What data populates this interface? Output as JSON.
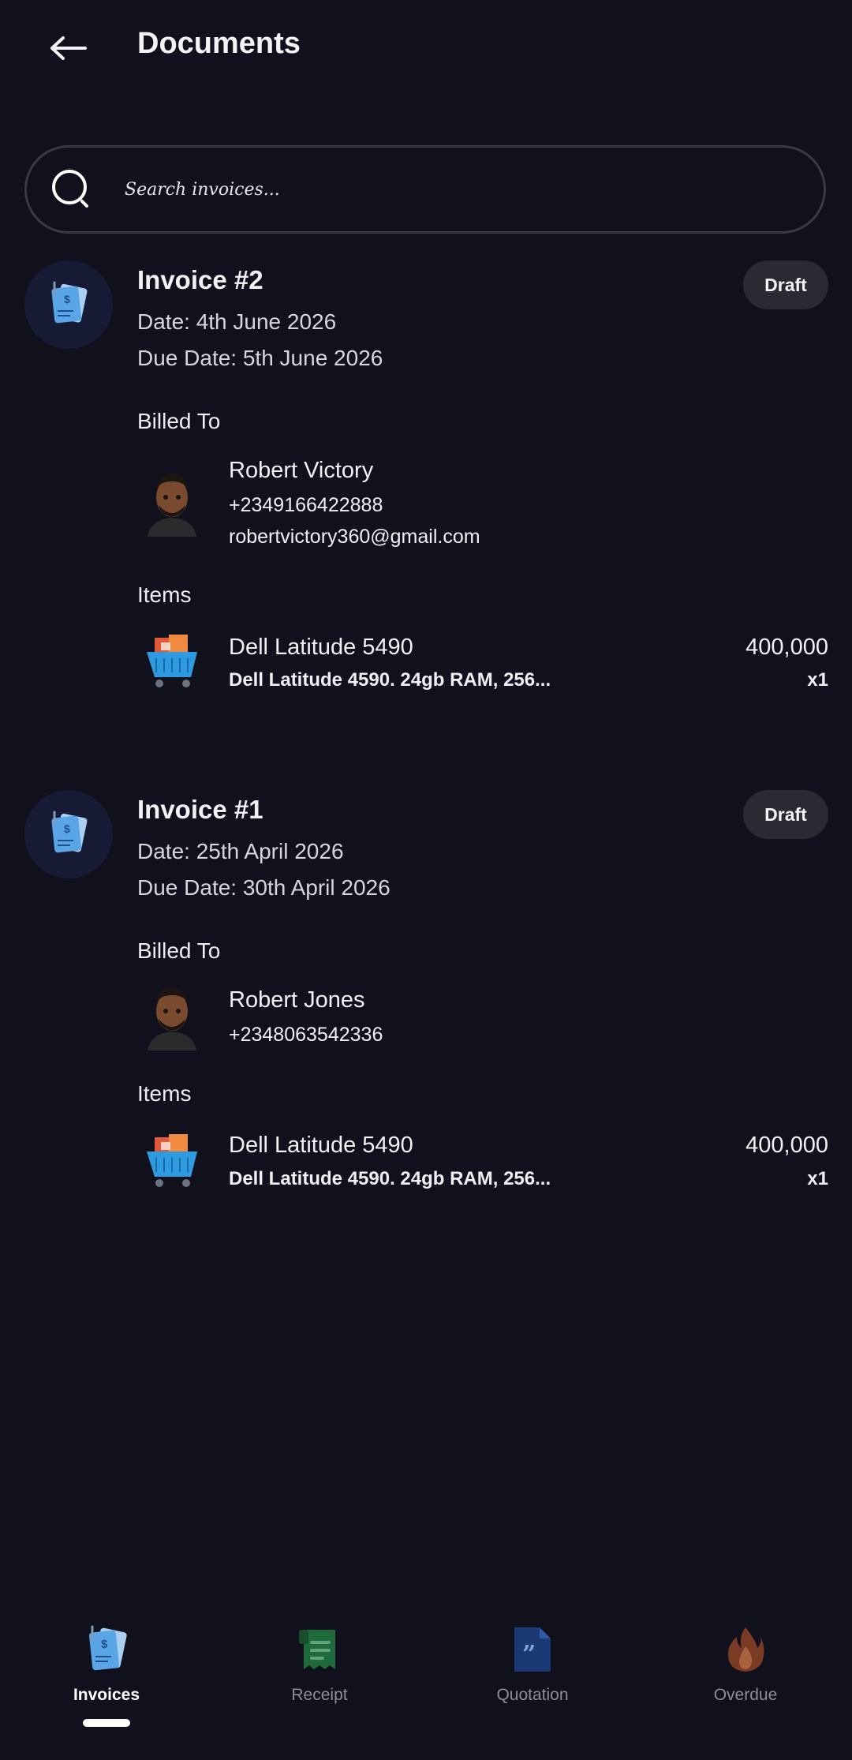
{
  "header": {
    "title": "Documents",
    "back_icon": "arrow-left-icon"
  },
  "search": {
    "placeholder": "Search invoices...",
    "value": "",
    "icon": "search-icon"
  },
  "invoices": [
    {
      "title": "Invoice #2",
      "status": "Draft",
      "date": "Date: 4th June 2026",
      "due_date": "Due Date: 5th June 2026",
      "billed_to_label": "Billed To",
      "client": {
        "name": "Robert Victory",
        "phone": "+2349166422888",
        "email": "robertvictory360@gmail.com"
      },
      "items_label": "Items",
      "items": [
        {
          "name": "Dell Latitude 5490",
          "description": "Dell Latitude 4590. 24gb RAM, 256...",
          "price": "400,000",
          "qty": "x1"
        }
      ]
    },
    {
      "title": "Invoice #1",
      "status": "Draft",
      "date": "Date: 25th April 2026",
      "due_date": "Due Date: 30th April 2026",
      "billed_to_label": "Billed To",
      "client": {
        "name": "Robert Jones",
        "phone": "+2348063542336"
      },
      "items_label": "Items",
      "items": [
        {
          "name": "Dell Latitude 5490",
          "description": "Dell Latitude 4590. 24gb RAM, 256...",
          "price": "400,000",
          "qty": "x1"
        }
      ]
    }
  ],
  "bottom_nav": {
    "items": [
      {
        "label": "Invoices",
        "icon": "invoice-icon",
        "active": true
      },
      {
        "label": "Receipt",
        "icon": "receipt-icon",
        "active": false
      },
      {
        "label": "Quotation",
        "icon": "quotation-icon",
        "active": false
      },
      {
        "label": "Overdue",
        "icon": "fire-icon",
        "active": false
      }
    ]
  },
  "colors": {
    "background": "#11111d",
    "badge": "#2a2a32",
    "search_border": "#3a3a45",
    "avatar_bg": "#171a35"
  }
}
